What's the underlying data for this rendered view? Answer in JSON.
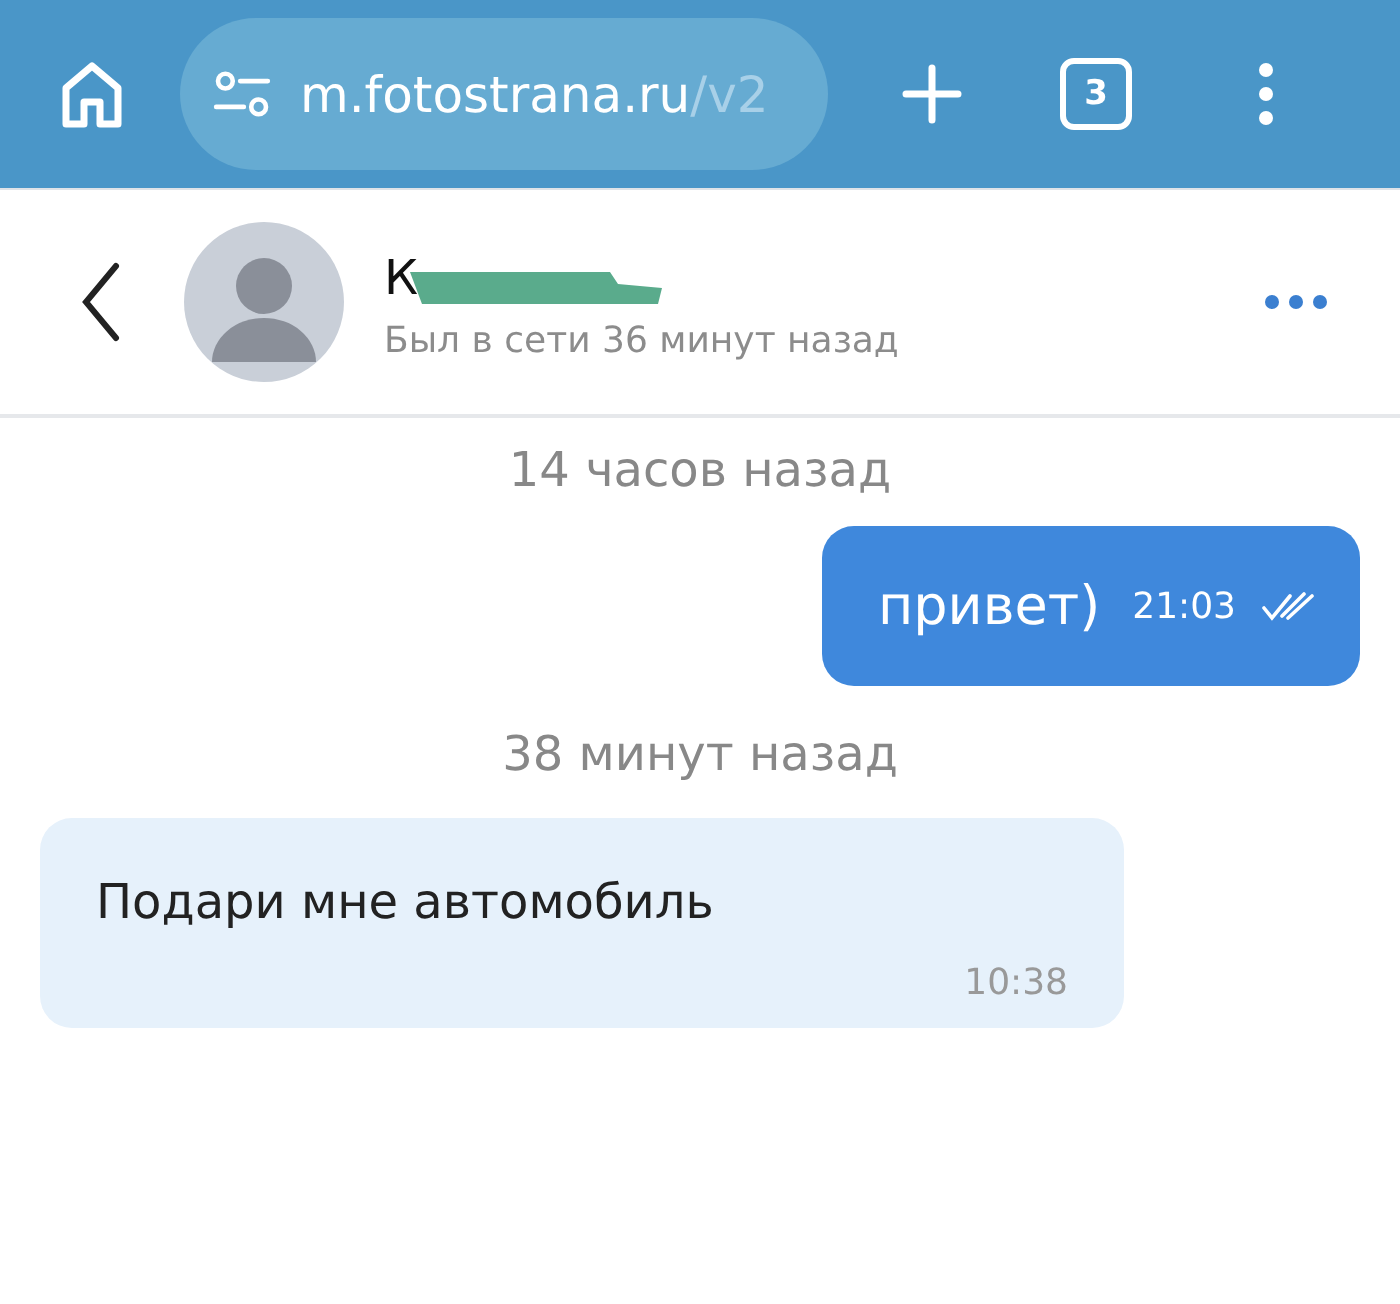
{
  "browser": {
    "url_host": "m.fotostrana.ru",
    "url_path": "/v2",
    "tab_count": "3"
  },
  "contact": {
    "name": "К",
    "status": "Был в сети 36 минут назад",
    "redacted": true
  },
  "messages": [
    {
      "kind": "divider",
      "text": "14 часов назад"
    },
    {
      "kind": "outgoing",
      "text": "привет)",
      "time": "21:03",
      "read": true
    },
    {
      "kind": "divider",
      "text": "38 минут назад"
    },
    {
      "kind": "incoming",
      "text": "Подари мне автомобиль",
      "time": "10:38"
    }
  ]
}
